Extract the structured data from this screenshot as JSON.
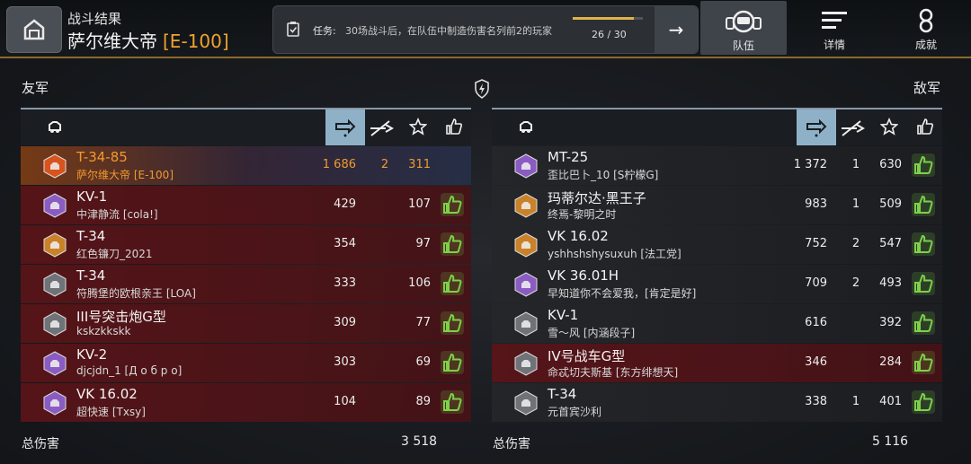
{
  "header": {
    "title_small": "战斗结果",
    "title_name": "萨尔维大帝",
    "title_tier": "[E-100]"
  },
  "mission": {
    "label": "任务:",
    "text": "30场战斗后，在队伍中制造伤害名列前2的玩家",
    "progress_text": "26 / 30",
    "progress_fraction": 0.867
  },
  "nav": {
    "team": "队伍",
    "details": "详情",
    "achievements": "成就"
  },
  "allies": {
    "label": "友军",
    "total_label": "总伤害",
    "total_value": "3 518",
    "rows": [
      {
        "vehicle": "T-34-85",
        "player": "萨尔维大帝 [E-100]",
        "damage": "1 686",
        "kills": "2",
        "xp": "311",
        "style": "player",
        "badge_color": "#d8541e",
        "like": false
      },
      {
        "vehicle": "KV-1",
        "player": "中津静流 [cola!]",
        "damage": "429",
        "kills": "",
        "xp": "107",
        "style": "red",
        "badge_color": "#8a5cc2",
        "like": true
      },
      {
        "vehicle": "T-34",
        "player": "红色镰刀_2021",
        "damage": "354",
        "kills": "",
        "xp": "97",
        "style": "red",
        "badge_color": "#c9822a",
        "like": true
      },
      {
        "vehicle": "T-34",
        "player": "符腾堡的欧根亲王 [LOA]",
        "damage": "333",
        "kills": "",
        "xp": "106",
        "style": "red",
        "badge_color": "#6f7378",
        "like": true
      },
      {
        "vehicle": "III号突击炮G型",
        "player": "kskzkkskk",
        "damage": "309",
        "kills": "",
        "xp": "77",
        "style": "red",
        "badge_color": "#6f7378",
        "like": true
      },
      {
        "vehicle": "KV-2",
        "player": "djcjdn_1 [Д о б р о]",
        "damage": "303",
        "kills": "",
        "xp": "69",
        "style": "red",
        "badge_color": "#8a5cc2",
        "like": true
      },
      {
        "vehicle": "VK 16.02",
        "player": "超快速 [Txsy]",
        "damage": "104",
        "kills": "",
        "xp": "89",
        "style": "red",
        "badge_color": "#8a5cc2",
        "like": true
      }
    ]
  },
  "enemies": {
    "label": "敌军",
    "total_label": "总伤害",
    "total_value": "5 116",
    "rows": [
      {
        "vehicle": "MT-25",
        "player": "歪比巴卜_10 [S柠檬G]",
        "damage": "1 372",
        "kills": "1",
        "xp": "630",
        "style": "green",
        "badge_color": "#8a5cc2",
        "like": true
      },
      {
        "vehicle": "玛蒂尔达·黑王子",
        "player": "终焉-黎明之时",
        "damage": "983",
        "kills": "1",
        "xp": "509",
        "style": "green",
        "badge_color": "#c9822a",
        "like": true
      },
      {
        "vehicle": "VK 16.02",
        "player": "yshhshshysuxuh [法工党]",
        "damage": "752",
        "kills": "2",
        "xp": "547",
        "style": "green",
        "badge_color": "#c9822a",
        "like": true
      },
      {
        "vehicle": "VK 36.01H",
        "player": "早知道你不会爱我，[肯定是好]",
        "damage": "709",
        "kills": "2",
        "xp": "493",
        "style": "green",
        "badge_color": "#8a5cc2",
        "like": true
      },
      {
        "vehicle": "KV-1",
        "player": "雪～风 [内涵段子]",
        "damage": "616",
        "kills": "",
        "xp": "392",
        "style": "green",
        "badge_color": "#6f7378",
        "like": true
      },
      {
        "vehicle": "IV号战车G型",
        "player": "命忒切夫斯基 [东方绯想天]",
        "damage": "346",
        "kills": "",
        "xp": "284",
        "style": "red",
        "badge_color": "#6f7378",
        "like": true
      },
      {
        "vehicle": "T-34",
        "player": "元首宾沙利",
        "damage": "338",
        "kills": "1",
        "xp": "401",
        "style": "green",
        "badge_color": "#6f7378",
        "like": true
      }
    ]
  },
  "colors": {
    "accent_orange": "#f0a22e",
    "like_green": "#7ed04a",
    "sort_active": "#8fb1c8"
  }
}
